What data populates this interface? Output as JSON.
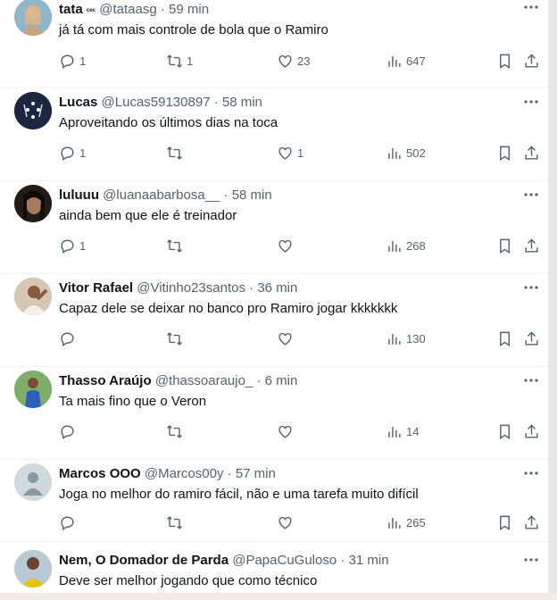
{
  "tweets": [
    {
      "name": "tata",
      "name_suffix": "ᶜᵉᶜ",
      "handle": "@tataasg",
      "time": "59 min",
      "text": "já tá com mais controle de bola que o Ramiro",
      "replies": "1",
      "retweets": "1",
      "likes": "23",
      "views": "647",
      "avatar_color": "#c9a37a",
      "avatar_icon": "profile-photo"
    },
    {
      "name": "Lucas",
      "name_suffix": "",
      "handle": "@Lucas59130897",
      "time": "58 min",
      "text": "Aproveitando os últimos dias na toca",
      "replies": "1",
      "retweets": "",
      "likes": "1",
      "views": "502",
      "avatar_color": "#1b2640",
      "avatar_icon": "cruzeiro-crest"
    },
    {
      "name": "luluuu",
      "name_suffix": "",
      "handle": "@luanaabarbosa__",
      "time": "58 min",
      "text": "ainda bem que ele é treinador",
      "replies": "1",
      "retweets": "",
      "likes": "",
      "views": "268",
      "avatar_color": "#3a2a22",
      "avatar_icon": "profile-photo"
    },
    {
      "name": "Vitor Rafael",
      "name_suffix": "",
      "handle": "@Vitinho23santos",
      "time": "36 min",
      "text": "Capaz dele se deixar no banco pro Ramiro jogar kkkkkkk",
      "replies": "",
      "retweets": "",
      "likes": "",
      "views": "130",
      "avatar_color": "#b58a6a",
      "avatar_icon": "profile-photo"
    },
    {
      "name": "Thasso Araújo",
      "name_suffix": "",
      "handle": "@thassoaraujo_",
      "time": "6 min",
      "text": "Ta mais fino que o Veron",
      "replies": "",
      "retweets": "",
      "likes": "",
      "views": "14",
      "avatar_color": "#6f9a5a",
      "avatar_icon": "profile-photo"
    },
    {
      "name": "Marcos OOO",
      "name_suffix": "",
      "handle": "@Marcos00y",
      "time": "57 min",
      "text": "Joga no melhor do ramiro fácil, não e uma tarefa muito difícil",
      "replies": "",
      "retweets": "",
      "likes": "",
      "views": "265",
      "avatar_color": "#cfd9de",
      "avatar_icon": "default-avatar"
    },
    {
      "name": "Nem, O Domador de Parda",
      "name_suffix": "",
      "handle": "@PapaCuGuloso",
      "time": "31 min",
      "text": "Deve ser melhor jogando que como técnico",
      "replies": "",
      "retweets": "",
      "likes": "",
      "views": "",
      "avatar_color": "#e5c100",
      "avatar_icon": "profile-photo"
    }
  ],
  "colors": {
    "text": "#0f1419",
    "secondary": "#536471",
    "divider": "#eff3f4"
  }
}
